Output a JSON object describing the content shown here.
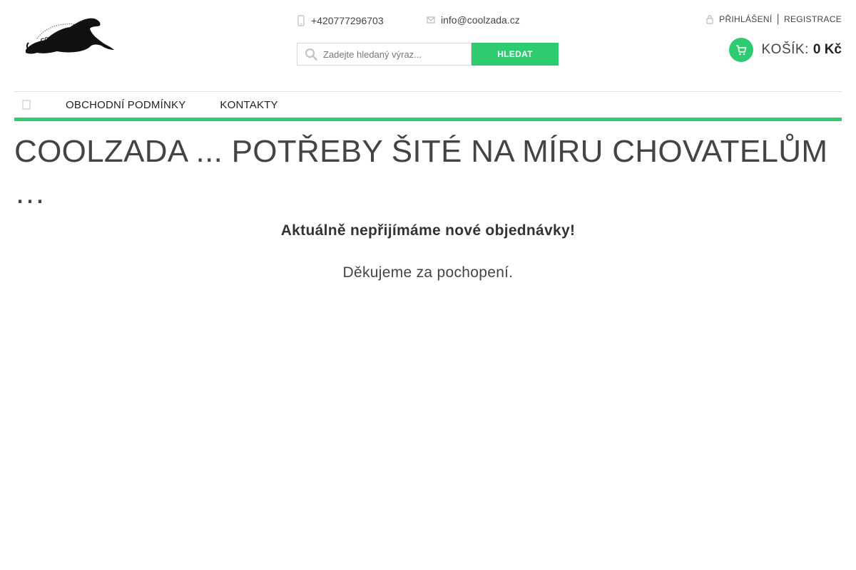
{
  "header": {
    "logo_icon": "coolzada-greyhound-logo",
    "logo_text": "COOLZADA",
    "phone": "+420777296703",
    "email": "info@coolzada.cz",
    "search": {
      "placeholder": "Zadejte hledaný výraz...",
      "value": "",
      "button_label": "HLEDAT"
    },
    "account": {
      "login_label": "PŘIHLÁŠENÍ",
      "separator": "|",
      "register_label": "REGISTRACE"
    },
    "cart": {
      "label": "KOŠÍK:",
      "amount": "0 Kč"
    }
  },
  "nav": {
    "home_icon": "home-icon",
    "items": [
      {
        "label": "OBCHODNÍ PODMÍNKY"
      },
      {
        "label": "KONTAKTY"
      }
    ]
  },
  "main": {
    "title": "COOLZADA ... POTŘEBY ŠITÉ NA MÍRU CHOVATELŮM …",
    "notice": "Aktuálně nepřijímáme nové objednávky!",
    "thanks": "Děkujeme za pochopení."
  },
  "colors": {
    "accent": "#2ecc71",
    "text": "#333333"
  }
}
